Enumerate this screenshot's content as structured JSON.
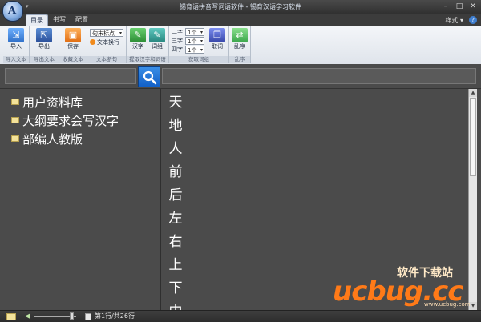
{
  "window": {
    "title": "锡育语拼音写词语软件 - 锡育汉语学习软件",
    "app_icon_letter": "A",
    "minimize": "–",
    "maximize": "□",
    "close": "✕"
  },
  "tabs": [
    {
      "label": "目录",
      "active": true
    },
    {
      "label": "书写",
      "active": false
    },
    {
      "label": "配置",
      "active": false
    }
  ],
  "style_menu": "样式 ▾",
  "help_icon": "?",
  "ribbon": {
    "groups": [
      {
        "label": "导入文本"
      },
      {
        "label": "导出文本"
      },
      {
        "label": "收藏文本"
      },
      {
        "label": "文本断句"
      },
      {
        "label": "提取汉字和词语"
      },
      {
        "label": "获取词组"
      },
      {
        "label": "乱序"
      }
    ],
    "import_label": "导入",
    "export_label": "导出",
    "save_label": "保存",
    "sentence_mode": "句末标点",
    "line_break_label": "文本换行",
    "hanzi_label": "汉字",
    "ciyu_label": "词组",
    "two_char_label": "二字",
    "two_char_value": "1个",
    "three_char_label": "三字",
    "three_char_value": "1个",
    "four_char_label": "四字",
    "four_char_value": "1个",
    "quci_label": "取词",
    "shuffle_label": "乱序"
  },
  "search": {
    "input_value": "",
    "display_value": ""
  },
  "tree": [
    {
      "label": "用户资料库"
    },
    {
      "label": "大纲要求会写汉字"
    },
    {
      "label": "部编人教版"
    }
  ],
  "characters": [
    "天",
    "地",
    "人",
    "前",
    "后",
    "左",
    "右",
    "上",
    "下",
    "中"
  ],
  "watermark": {
    "main": "ucbug.cc",
    "sub": "软件下载站",
    "url": "www.ucbug.com"
  },
  "status": {
    "text": "第1行/共26行",
    "volume": 0.9
  },
  "colors": {
    "accent": "#1160c8",
    "background": "#4b4b4b",
    "watermark": "#ff7a18"
  },
  "icons": [
    "app-icon",
    "import-icon",
    "export-icon",
    "save-icon",
    "hanzi-icon",
    "ciyu-icon",
    "quci-icon",
    "shuffle-icon",
    "search-icon",
    "folder-icon",
    "speaker-icon",
    "document-icon"
  ]
}
